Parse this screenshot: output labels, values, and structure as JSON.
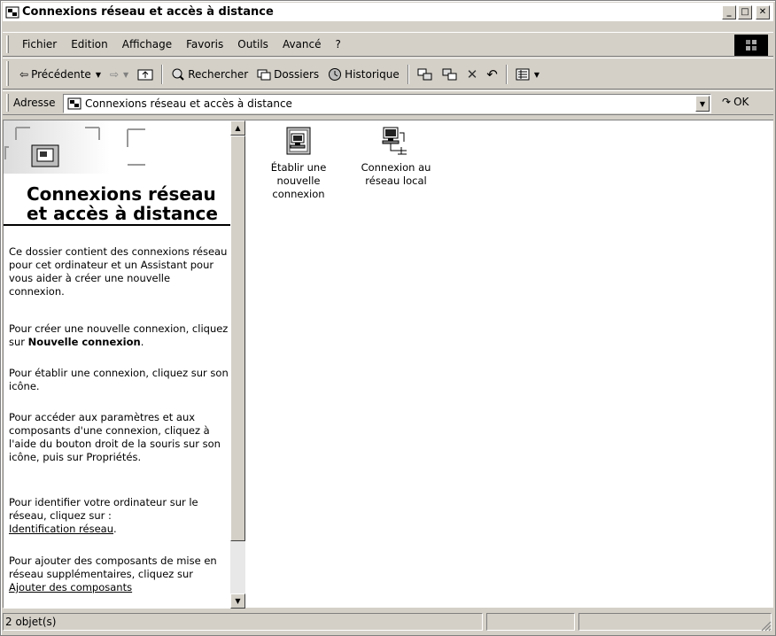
{
  "window": {
    "title": "Connexions réseau et accès à distance",
    "buttons": {
      "minimize": "_",
      "maximize": "□",
      "close": "✕"
    }
  },
  "menubar": {
    "items": [
      "Fichier",
      "Edition",
      "Affichage",
      "Favoris",
      "Outils",
      "Avancé",
      "?"
    ]
  },
  "toolbar": {
    "back_label": "Précédente",
    "search_label": "Rechercher",
    "folders_label": "Dossiers",
    "history_label": "Historique"
  },
  "address": {
    "label": "Adresse",
    "value": "Connexions réseau et accès à distance",
    "go_label": "OK"
  },
  "leftpane": {
    "title": "Connexions réseau et accès à distance",
    "paragraphs": {
      "p1": "Ce dossier contient des connexions réseau pour cet ordinateur et un Assistant pour vous aider à créer une nouvelle connexion.",
      "p2_prefix": "Pour créer une nouvelle connexion, cliquez sur ",
      "p2_bold": "Nouvelle connexion",
      "p2_suffix": ".",
      "p3": "Pour établir une connexion, cliquez sur son icône.",
      "p4": "Pour accéder aux paramètres et aux composants d'une connexion, cliquez à l'aide du bouton droit de la souris sur son icône, puis sur Propriétés.",
      "p5_prefix": "Pour identifier votre ordinateur sur le réseau, cliquez sur :",
      "p5_link": "Identification réseau",
      "p5_suffix": ".",
      "p6_prefix": "Pour ajouter des composants de mise en réseau supplémentaires, cliquez sur ",
      "p6_link": "Ajouter des composants"
    }
  },
  "items": [
    {
      "label": "Établir une nouvelle connexion",
      "icon": "new-connection-icon"
    },
    {
      "label": "Connexion au réseau local",
      "icon": "lan-connection-icon"
    }
  ],
  "statusbar": {
    "text": "2 objet(s)"
  }
}
